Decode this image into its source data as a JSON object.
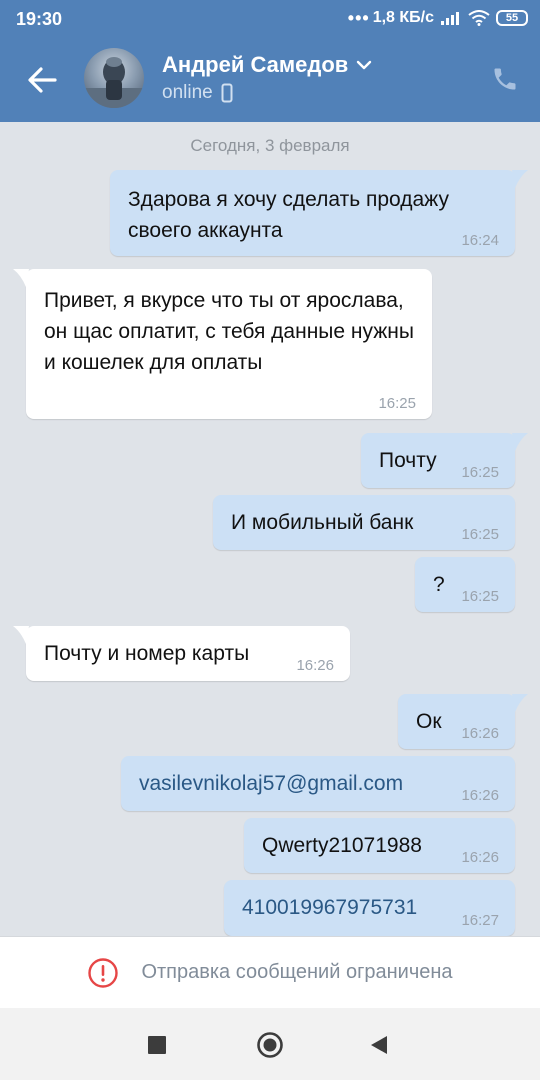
{
  "status_bar": {
    "time": "19:30",
    "network_speed": "1,8 КБ/с",
    "battery": "55"
  },
  "toolbar": {
    "back_icon": "arrow-left-icon",
    "contact_name": "Андрей Самедов",
    "contact_status": "online",
    "call_icon": "phone-icon"
  },
  "chat": {
    "date_separator": "Сегодня, 3 февраля",
    "messages": [
      {
        "direction": "out",
        "text": "Здарова я хочу сделать продажу своего аккаунта",
        "time": "16:24"
      },
      {
        "direction": "in",
        "text": "Привет, я вкурсе что ты от ярослава, он щас оплатит, с тебя данные нужны и кошелек для оплаты",
        "time": "16:25"
      },
      {
        "direction": "out",
        "text": "Почту",
        "time": "16:25"
      },
      {
        "direction": "out",
        "text": "И мобильный банк",
        "time": "16:25"
      },
      {
        "direction": "out",
        "text": "?",
        "time": "16:25"
      },
      {
        "direction": "in",
        "text": "Почту и номер карты",
        "time": "16:26"
      },
      {
        "direction": "out",
        "text": "Ок",
        "time": "16:26"
      },
      {
        "direction": "out",
        "text": "vasilevnikolaj57@gmail.com",
        "time": "16:26"
      },
      {
        "direction": "out",
        "text": "Qwerty21071988",
        "time": "16:26"
      },
      {
        "direction": "out",
        "text": "410019967975731",
        "time": "16:27"
      }
    ]
  },
  "restriction": {
    "text": "Отправка сообщений ограничена",
    "icon": "alert-circle-icon",
    "icon_color": "#e64646"
  },
  "colors": {
    "header": "#5181b8",
    "outgoing_bubble": "#cce0f5",
    "incoming_bubble": "#ffffff",
    "chat_background": "#dfe3e8",
    "link": "#2a5885"
  }
}
